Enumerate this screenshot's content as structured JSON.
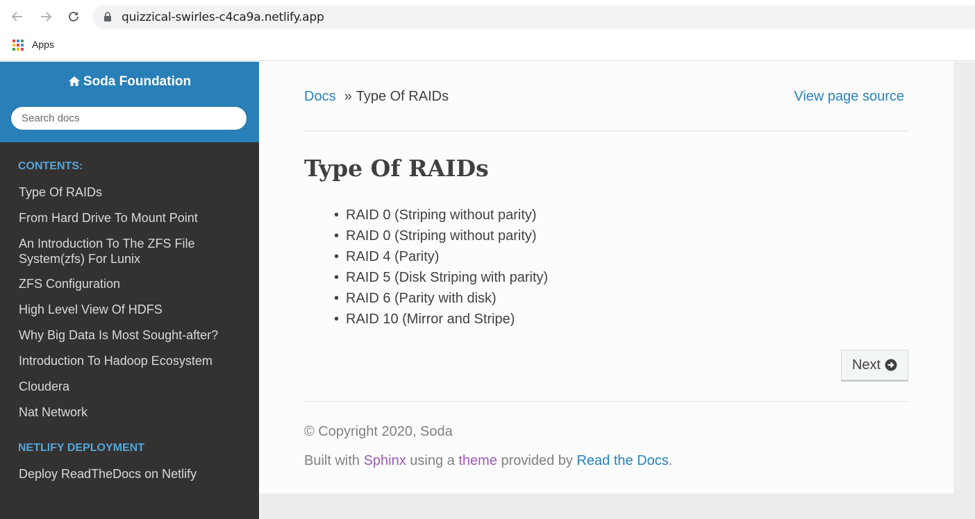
{
  "browser": {
    "url": "quizzical-swirles-c4ca9a.netlify.app",
    "bookmarks": {
      "apps_label": "Apps"
    }
  },
  "sidebar": {
    "brand": "Soda Foundation",
    "search_placeholder": "Search docs",
    "sections": [
      {
        "caption": "CONTENTS:",
        "items": [
          "Type Of RAIDs",
          "From Hard Drive To Mount Point",
          "An Introduction To The ZFS File System(zfs) For Lunix",
          "ZFS Configuration",
          "High Level View Of HDFS",
          "Why Big Data Is Most Sought-after?",
          "Introduction To Hadoop Ecosystem",
          "Cloudera",
          "Nat Network"
        ]
      },
      {
        "caption": "NETLIFY DEPLOYMENT",
        "items": [
          "Deploy ReadTheDocs on Netlify"
        ]
      }
    ]
  },
  "main": {
    "breadcrumb": {
      "root": "Docs",
      "separator": "»",
      "current": "Type Of RAIDs"
    },
    "view_source": "View page source",
    "title": "Type Of RAIDs",
    "bullets": [
      "RAID 0 (Striping without parity)",
      "RAID 0 (Striping without parity)",
      "RAID 4 (Parity)",
      "RAID 5 (Disk Striping with parity)",
      "RAID 6 (Parity with disk)",
      "RAID 10 (Mirror and Stripe)"
    ],
    "next_label": "Next"
  },
  "footer": {
    "copyright": "© Copyright 2020, Soda",
    "built_prefix": "Built with ",
    "sphinx": "Sphinx",
    "using_a": " using a ",
    "theme": "theme",
    "provided_by": " provided by ",
    "rtd": "Read the Docs",
    "period": "."
  },
  "colors": {
    "sidebar_bg": "#343131",
    "sidebar_header": "#2980b9",
    "caption": "#55a5d9",
    "link_blue": "#2980b9",
    "link_purple": "#9b59b6"
  }
}
